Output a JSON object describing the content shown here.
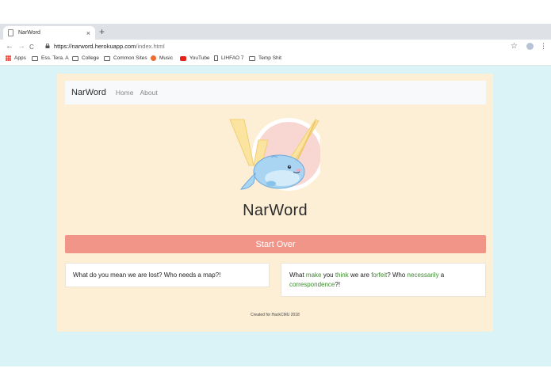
{
  "browser": {
    "tab_title": "NarWord",
    "tab_close": "×",
    "new_tab": "+",
    "url_host": "https://narword.herokuapp.com",
    "url_path": "/index.html",
    "back": "←",
    "forward": "→",
    "reload": "C",
    "star": "☆",
    "menu": "⋮",
    "bookmarks": [
      {
        "label": "Apps",
        "icon": "apps-icon"
      },
      {
        "label": "Ess. Tera. A",
        "icon": "folder-icon"
      },
      {
        "label": "College",
        "icon": "folder-icon"
      },
      {
        "label": "Common Sites",
        "icon": "folder-icon"
      },
      {
        "label": "Music",
        "icon": "music-icon"
      },
      {
        "label": "YouTube",
        "icon": "youtube-icon"
      },
      {
        "label": "LIHFAO 7",
        "icon": "document-icon"
      },
      {
        "label": "Temp Shit",
        "icon": "folder-icon"
      }
    ]
  },
  "nav": {
    "brand": "NarWord",
    "links": [
      "Home",
      "About"
    ]
  },
  "main": {
    "title": "NarWord",
    "start_over": "Start Over"
  },
  "sentences": {
    "left": "What do you mean we are lost? Who needs a map?!",
    "right": {
      "w1": "What ",
      "h1": "make",
      "w2": " you ",
      "h2": "think",
      "w3": " we are ",
      "h3": "forfeit",
      "w4": "? Who ",
      "h4": "necessarily",
      "w5": " a ",
      "h5": "correspondence",
      "w6": "?!"
    }
  },
  "footer": "Created for HackCMU 2018",
  "colors": {
    "page_bg": "#daf3f7",
    "card_bg": "#fdefd6",
    "button": "#f09587",
    "highlight": "#3e8a2f"
  }
}
